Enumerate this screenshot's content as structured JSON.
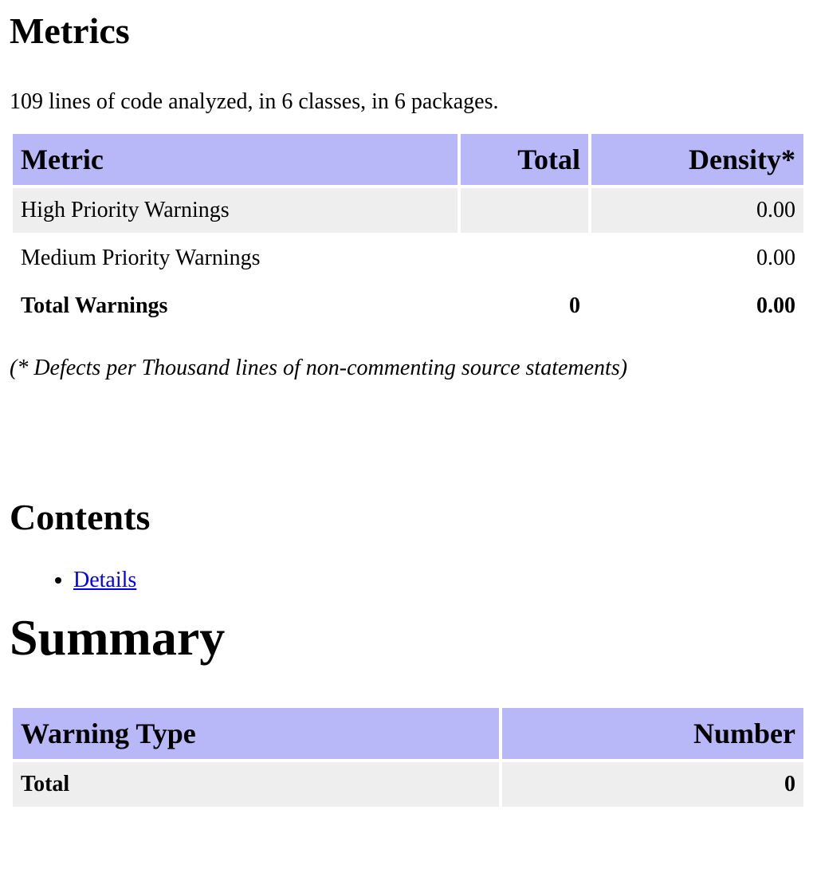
{
  "metrics": {
    "heading": "Metrics",
    "summary_line": "109 lines of code analyzed, in 6 classes, in 6 packages.",
    "columns": [
      "Metric",
      "Total",
      "Density*"
    ],
    "rows": [
      {
        "label": "High Priority Warnings",
        "total": "",
        "density": "0.00"
      },
      {
        "label": "Medium Priority Warnings",
        "total": "",
        "density": "0.00"
      },
      {
        "label": "Total Warnings",
        "total": "0",
        "density": "0.00"
      }
    ],
    "footnote": "(* Defects per Thousand lines of non-commenting source statements)"
  },
  "contents": {
    "heading": "Contents",
    "links": [
      "Details"
    ]
  },
  "summary": {
    "heading": "Summary",
    "columns": [
      "Warning Type",
      "Number"
    ],
    "rows": [
      {
        "label": "Total",
        "number": "0"
      }
    ]
  }
}
